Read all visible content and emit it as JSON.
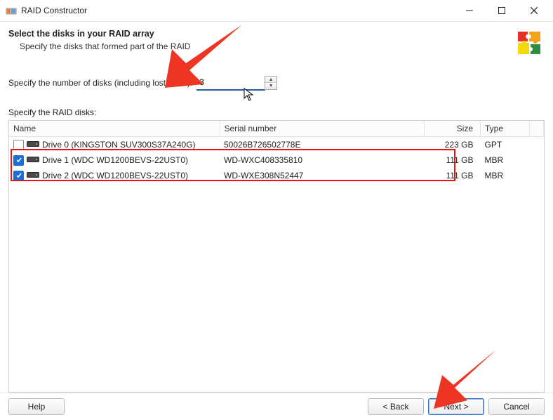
{
  "window": {
    "title": "RAID Constructor"
  },
  "header": {
    "title": "Select the disks in your RAID array",
    "subtitle": "Specify the disks that formed part of the RAID"
  },
  "num_disks": {
    "label": "Specify the number of disks (including lost disks):",
    "value": "3"
  },
  "section_label": "Specify the RAID disks:",
  "table": {
    "columns": {
      "name": "Name",
      "serial": "Serial number",
      "size": "Size",
      "type": "Type"
    },
    "rows": [
      {
        "checked": false,
        "name": "Drive 0 (KINGSTON SUV300S37A240G)",
        "serial": "50026B726502778E",
        "size": "223 GB",
        "type": "GPT"
      },
      {
        "checked": true,
        "name": "Drive 1 (WDC WD1200BEVS-22UST0)",
        "serial": "WD-WXC408335810",
        "size": "111 GB",
        "type": "MBR"
      },
      {
        "checked": true,
        "name": "Drive 2 (WDC WD1200BEVS-22UST0)",
        "serial": "WD-WXE308N52447",
        "size": "111 GB",
        "type": "MBR"
      }
    ]
  },
  "footer": {
    "help": "Help",
    "back": "< Back",
    "next": "Next >",
    "cancel": "Cancel"
  }
}
